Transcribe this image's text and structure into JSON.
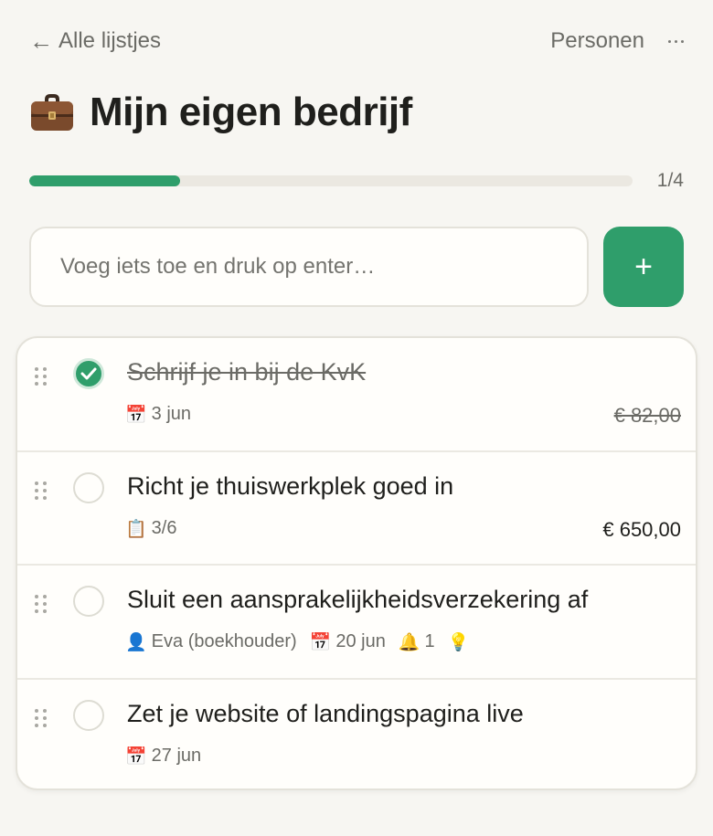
{
  "nav": {
    "back_label": "Alle lijstjes",
    "people_label": "Personen"
  },
  "header": {
    "title": "Mijn eigen bedrijf",
    "icon": "briefcase-icon"
  },
  "progress": {
    "done": 1,
    "total": 4,
    "fraction": 0.25,
    "label": "1/4",
    "color": "#2f9e6b"
  },
  "add": {
    "placeholder": "Voeg iets toe en druk op enter…",
    "button_label": "+"
  },
  "tasks": [
    {
      "title": "Schrijf je in bij de KvK",
      "done": true,
      "meta": [
        {
          "icon": "calendar-icon",
          "text": "3 jun"
        }
      ],
      "amount": "€ 82,00"
    },
    {
      "title": "Richt je thuiswerkplek goed in",
      "done": false,
      "meta": [
        {
          "icon": "clipboard-icon",
          "text": "3/6"
        }
      ],
      "amount": "€ 650,00"
    },
    {
      "title": "Sluit een aansprakelijkheidsverzekering af",
      "done": false,
      "meta": [
        {
          "icon": "person-icon",
          "text": "Eva (boekhouder)"
        },
        {
          "icon": "calendar-icon",
          "text": "20 jun"
        },
        {
          "icon": "bell-icon",
          "text": "1"
        },
        {
          "icon": "lightbulb-icon",
          "text": ""
        }
      ],
      "amount": ""
    },
    {
      "title": "Zet je website of landingspagina live",
      "done": false,
      "meta": [
        {
          "icon": "calendar-icon",
          "text": "27 jun"
        }
      ],
      "amount": ""
    }
  ],
  "colors": {
    "accent": "#2f9e6b",
    "background": "#f7f6f2",
    "card": "#fffefb"
  }
}
